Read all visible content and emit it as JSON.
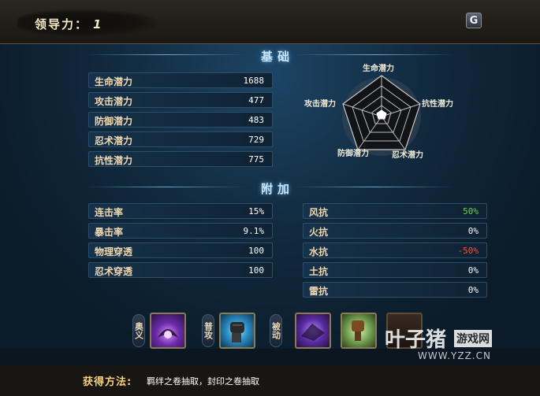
{
  "header": {
    "leadership_label": "领导力：",
    "leadership_value": "1",
    "settings_glyph": "G"
  },
  "basic": {
    "title": "基础",
    "stats": [
      {
        "label": "生命潜力",
        "value": "1688"
      },
      {
        "label": "攻击潜力",
        "value": "477"
      },
      {
        "label": "防御潜力",
        "value": "483"
      },
      {
        "label": "忍术潜力",
        "value": "729"
      },
      {
        "label": "抗性潜力",
        "value": "775"
      }
    ],
    "pentagon_labels": {
      "top": "生命潜力",
      "right": "抗性潜力",
      "bottom_right": "忍术潜力",
      "bottom_left": "防御潜力",
      "left": "攻击潜力"
    }
  },
  "extra": {
    "title": "附加",
    "stats": [
      {
        "label": "连击率",
        "value": "15%"
      },
      {
        "label": "暴击率",
        "value": "9.1%"
      },
      {
        "label": "物理穿透",
        "value": "100"
      },
      {
        "label": "忍术穿透",
        "value": "100"
      }
    ],
    "resistances": [
      {
        "label": "风抗",
        "value": "50%",
        "color": "#6fd04a"
      },
      {
        "label": "火抗",
        "value": "0%",
        "color": "#ffffff"
      },
      {
        "label": "水抗",
        "value": "-50%",
        "color": "#ff4a3a"
      },
      {
        "label": "土抗",
        "value": "0%",
        "color": "#ffffff"
      },
      {
        "label": "雷抗",
        "value": "0%",
        "color": "#ffffff"
      }
    ]
  },
  "skills": {
    "tags": [
      "奥义",
      "普攻",
      "被动"
    ],
    "icons": [
      "ultimate-skill-icon",
      "basic-attack-fist-icon",
      "passive-skill-icon-1",
      "passive-skill-icon-2",
      "passive-skill-icon-3"
    ]
  },
  "footer": {
    "obtain_label": "获得方法:",
    "obtain_text": "羁绊之卷抽取，封印之卷抽取"
  },
  "watermark": {
    "brand": "叶子猪",
    "tag": "游戏网",
    "url": "WWW.YZZ.CN"
  }
}
